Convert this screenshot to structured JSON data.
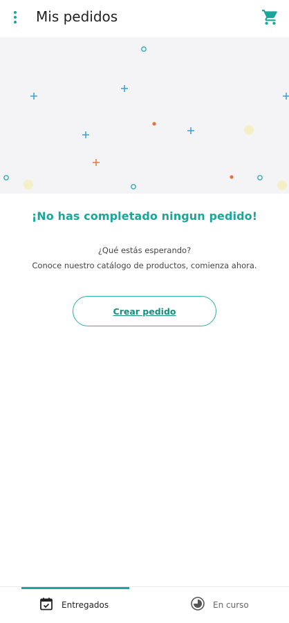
{
  "header": {
    "title": "Mis pedidos",
    "menu_icon": "more-vert-icon",
    "cart_icon": "shopping-cart-icon",
    "accent_color": "#1aa698"
  },
  "empty_state": {
    "title": "¡No has completado ningun pedido!",
    "line1": "¿Qué estás esperando?",
    "line2": "Conoce nuestro catálogo de productos, comienza ahora.",
    "create_button": "Crear pedido"
  },
  "tabs": [
    {
      "label": "Entregados",
      "icon": "calendar-check-icon",
      "active": true
    },
    {
      "label": "En curso",
      "icon": "clock-progress-icon",
      "active": false
    }
  ]
}
